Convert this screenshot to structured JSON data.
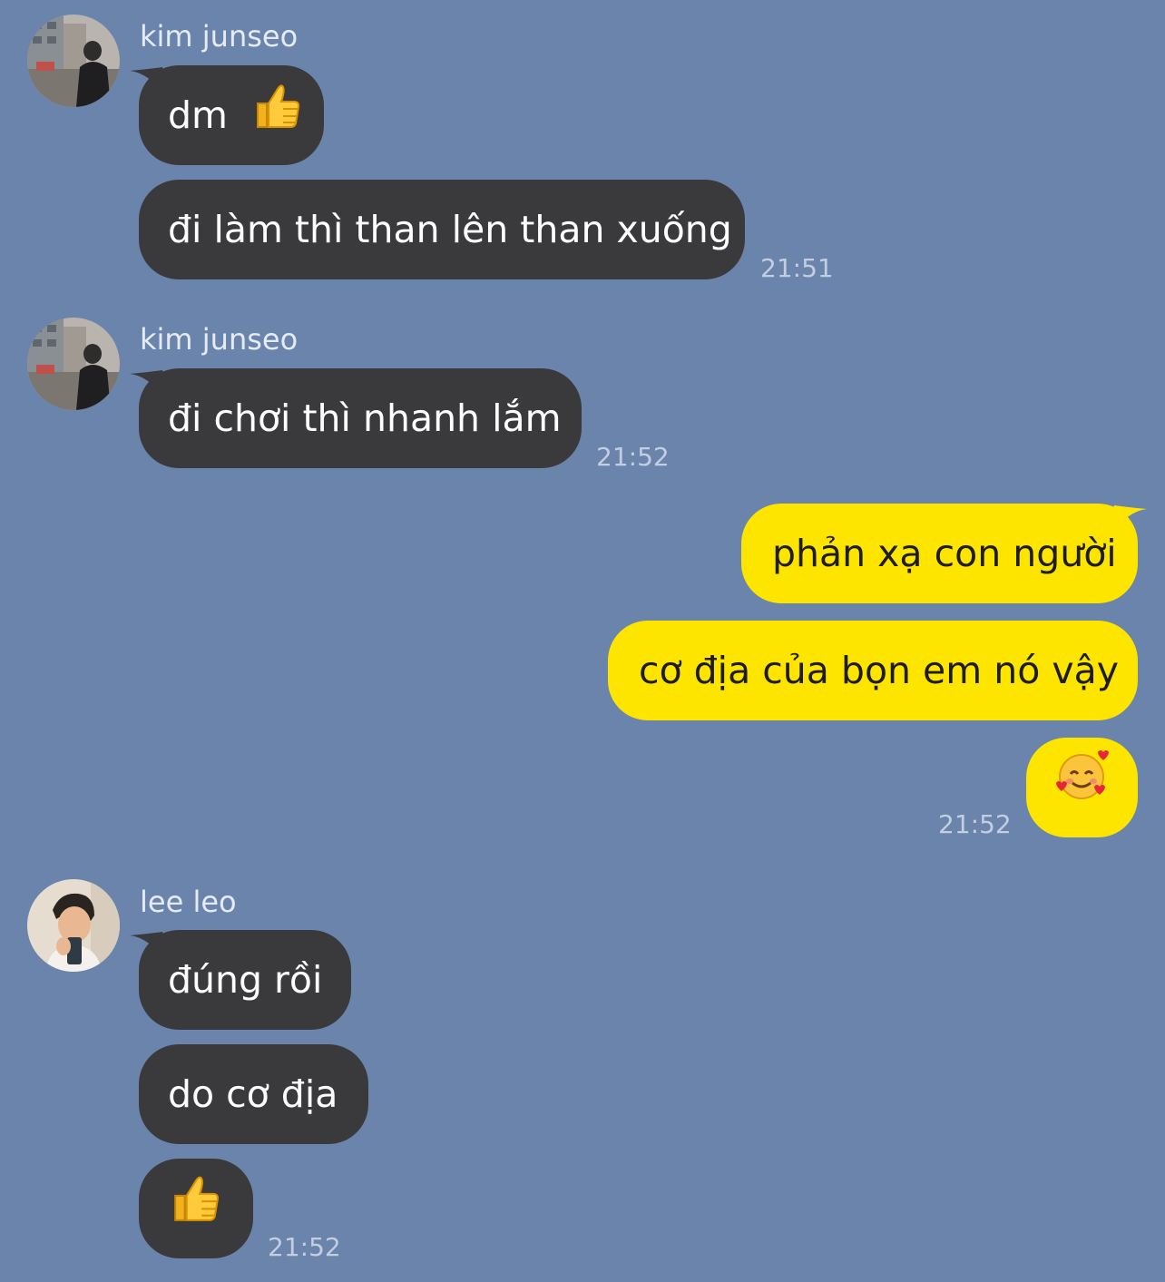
{
  "messages": {
    "group1": {
      "sender": "kim junseo",
      "bubble1": "dm",
      "bubble1_emoji": "thumbs-up-emoji",
      "bubble2": "đi làm thì than lên than xuống",
      "time": "21:51"
    },
    "group2": {
      "sender": "kim junseo",
      "bubble1": "đi chơi thì nhanh lắm",
      "time": "21:52"
    },
    "group3": {
      "bubble1": "phản xạ con người",
      "bubble2": "cơ địa của bọn em nó vậy",
      "bubble3_emoji": "smiling-face-with-hearts-emoji",
      "time": "21:52"
    },
    "group4": {
      "sender": "lee leo",
      "bubble1": "đúng rồi",
      "bubble2": "do cơ địa",
      "bubble3_emoji": "thumbs-up-emoji",
      "time": "21:52"
    }
  },
  "colors": {
    "background": "#6a84ab",
    "incoming_bubble": "#3a3a3d",
    "outgoing_bubble": "#fee500",
    "sender_text": "#e4ebf5",
    "timestamp": "#c3cfe0"
  }
}
